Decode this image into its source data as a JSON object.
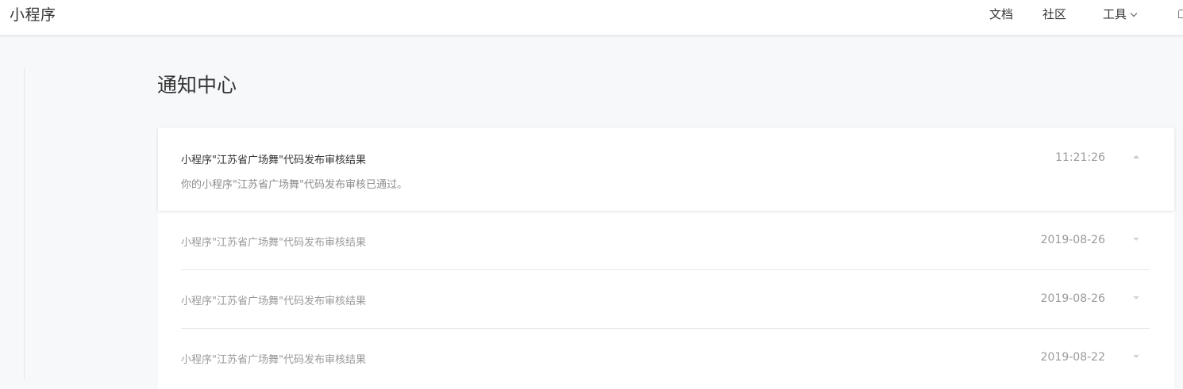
{
  "header": {
    "brand": "小程序",
    "nav": {
      "docs": "文档",
      "community": "社区",
      "tools": "工具"
    }
  },
  "page": {
    "title": "通知中心"
  },
  "notifications": [
    {
      "title": "小程序\"江苏省广场舞\"代码发布审核结果",
      "body": "你的小程序\"江苏省广场舞\"代码发布审核已通过。",
      "time": "11:21:26",
      "expanded": true
    },
    {
      "title": "小程序\"江苏省广场舞\"代码发布审核结果",
      "time": "2019-08-26",
      "expanded": false
    },
    {
      "title": "小程序\"江苏省广场舞\"代码发布审核结果",
      "time": "2019-08-26",
      "expanded": false
    },
    {
      "title": "小程序\"江苏省广场舞\"代码发布审核结果",
      "time": "2019-08-22",
      "expanded": false
    }
  ],
  "colors": {
    "background": "#f7f8fa",
    "text_primary": "#353535",
    "text_muted": "#9a9a9a"
  }
}
